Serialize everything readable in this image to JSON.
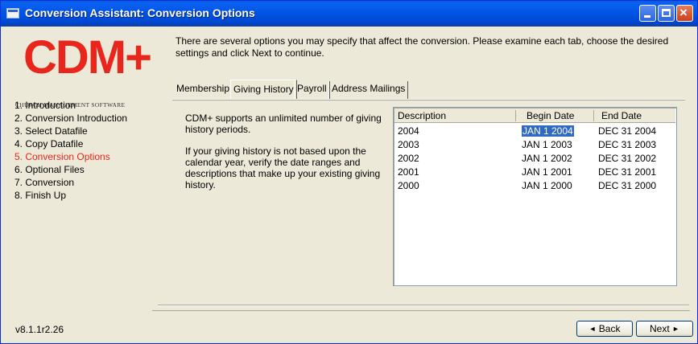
{
  "window": {
    "title": "Conversion Assistant: Conversion Options",
    "close_glyph": "×"
  },
  "logo": {
    "main": "CDM+",
    "sub": "CHURCH MANAGEMENT SOFTWARE"
  },
  "steps": [
    {
      "label": "1. Introduction",
      "active": false
    },
    {
      "label": "2. Conversion Introduction",
      "active": false
    },
    {
      "label": "3. Select Datafile",
      "active": false
    },
    {
      "label": "4. Copy Datafile",
      "active": false
    },
    {
      "label": "5. Conversion Options",
      "active": true
    },
    {
      "label": "6. Optional Files",
      "active": false
    },
    {
      "label": "7. Conversion",
      "active": false
    },
    {
      "label": "8. Finish Up",
      "active": false
    }
  ],
  "version": "v8.1.1r2.26",
  "intro": "There are several options you may specify that affect the conversion. Please examine each tab, choose the desired settings and click Next to continue.",
  "tabs": [
    {
      "label": "Membership"
    },
    {
      "label": "Giving History",
      "selected": true
    },
    {
      "label": "Payroll"
    },
    {
      "label": "Address Mailings"
    }
  ],
  "giving": {
    "desc1": "CDM+ supports an unlimited number of giving history periods.",
    "desc2": "If your giving history is not based upon the calendar year, verify the date ranges and descriptions that make up your existing giving history.",
    "columns": [
      "Description",
      "Begin Date",
      "End Date"
    ],
    "rows": [
      {
        "description": "2004",
        "begin": "JAN 1 2004",
        "end": "DEC 31 2004",
        "begin_selected": true
      },
      {
        "description": "2003",
        "begin": "JAN 1 2003",
        "end": "DEC 31 2003"
      },
      {
        "description": "2002",
        "begin": "JAN 1 2002",
        "end": "DEC 31 2002"
      },
      {
        "description": "2001",
        "begin": "JAN 1 2001",
        "end": "DEC 31 2001"
      },
      {
        "description": "2000",
        "begin": "JAN 1 2000",
        "end": "DEC 31 2000"
      }
    ]
  },
  "buttons": {
    "back": "Back",
    "next": "Next",
    "back_arrow": "◄",
    "next_arrow": "►"
  },
  "colors": {
    "accent_red": "#e8261c",
    "titlebar_blue": "#0055e5",
    "selection_blue": "#316ac5"
  }
}
